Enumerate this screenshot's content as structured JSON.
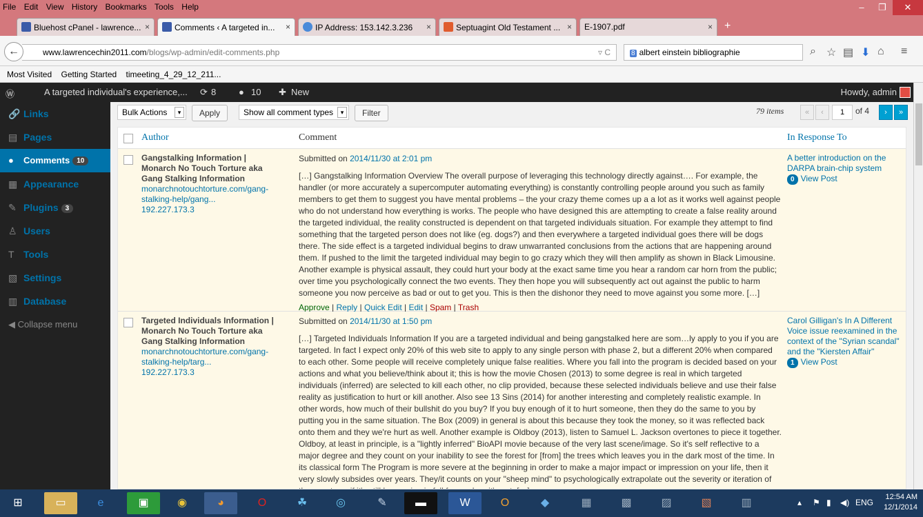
{
  "browser": {
    "menu": [
      "File",
      "Edit",
      "View",
      "History",
      "Bookmarks",
      "Tools",
      "Help"
    ],
    "tabs": [
      {
        "label": "Bluehost cPanel - lawrence...",
        "close": "×",
        "color": "#3b5ba8"
      },
      {
        "label": "Comments ‹ A targeted in...",
        "close": "×",
        "color": "#3b5ba8"
      },
      {
        "label": "IP Address: 153.142.3.236",
        "close": "×",
        "color": "#4b8ad9"
      },
      {
        "label": "Septuagint Old Testament ...",
        "close": "×",
        "color": "#e05c2e"
      },
      {
        "label": "E-1907.pdf",
        "close": "×",
        "color": "#e6d8d9"
      }
    ],
    "new_tab": "+",
    "url_host": "www.lawrencechin2011.com",
    "url_path": "/blogs/wp-admin/edit-comments.php",
    "search": "albert einstein bibliographie",
    "bookmarks": [
      "Most Visited",
      "Getting Started",
      "timeeting_4_29_12_211..."
    ]
  },
  "adminbar": {
    "site": "A targeted individual's experience,...",
    "updates": "8",
    "comments": "10",
    "new": "New",
    "howdy": "Howdy, admin"
  },
  "sidebar": {
    "items": [
      {
        "label": "Links",
        "icon": "link-icon",
        "glyph": "🔗"
      },
      {
        "label": "Pages",
        "icon": "pages-icon",
        "glyph": "▤"
      },
      {
        "label": "Comments",
        "icon": "comment-icon",
        "glyph": "●",
        "count": "10"
      },
      {
        "label": "Appearance",
        "icon": "appearance-icon",
        "glyph": "▦"
      },
      {
        "label": "Plugins",
        "icon": "plugin-icon",
        "glyph": "✎",
        "count": "3"
      },
      {
        "label": "Users",
        "icon": "users-icon",
        "glyph": "♙"
      },
      {
        "label": "Tools",
        "icon": "tools-icon",
        "glyph": "T"
      },
      {
        "label": "Settings",
        "icon": "settings-icon",
        "glyph": "▧"
      },
      {
        "label": "Database",
        "icon": "database-icon",
        "glyph": "▥"
      }
    ],
    "collapse": "Collapse menu"
  },
  "toolbar": {
    "bulk": "Bulk Actions",
    "apply": "Apply",
    "types": "Show all comment types",
    "filter": "Filter",
    "items": "79 items",
    "first": "«",
    "prev": "‹",
    "page": "1",
    "of": "of 4",
    "next": "›",
    "last": "»"
  },
  "table": {
    "col_author": "Author",
    "col_comment": "Comment",
    "col_response": "In Response To"
  },
  "comments": [
    {
      "author": "Gangstalking Information | Monarch No Touch Torture aka Gang Stalking Information",
      "url": "monarchnotouchtorture.com/gang-stalking-help/gang...",
      "ip": "192.227.173.3",
      "submitted_prefix": "Submitted on",
      "date": "2014/11/30 at 2:01 pm",
      "text": "[…] Gangstalking Information Overview The overall purpose of leveraging this technology directly against…. For example, the handler (or more accurately a supercomputer automating everything) is constantly controlling people around you such as family members to get them to suggest you have mental problems – the your crazy theme comes up a a lot as it works well against people who do not understand how everything is works. The people who have designed this are attempting to create a false reality around the targeted individual, the reality constructed is dependent on that targeted individuals situation. For example they attempt to find something that the targeted person does not like (eg. dogs?) and then everywhere a targeted individual goes there will be dogs there. The side effect is a targeted individual begins to draw unwarranted conclusions from the actions that are happening around them. If pushed to the limit the targeted individual may begin to go crazy which they will then amplify as shown in Black Limousine. Another example is physical assault, they could hurt your body at the exact same time you hear a random car horn from the public; over time you psychologically connect the two events. They then hope you will subsequently act out against the public to harm someone you now perceive as bad or out to get you. This is then the dishonor they need to move against you some more. […]",
      "actions": {
        "approve": "Approve",
        "reply": "Reply",
        "quick": "Quick Edit",
        "edit": "Edit",
        "spam": "Spam",
        "trash": "Trash"
      },
      "response": "A better introduction on the DARPA brain-chip system",
      "resp_count": "0",
      "view": "View Post"
    },
    {
      "author": "Targeted Individuals Information | Monarch No Touch Torture aka Gang Stalking Information",
      "url": "monarchnotouchtorture.com/gang-stalking-help/targ...",
      "ip": "192.227.173.3",
      "submitted_prefix": "Submitted on",
      "date": "2014/11/30 at 1:50 pm",
      "text": "[…] Targeted Individuals Information If you are a targeted individual and being gangstalked here are som…ly apply to you if you are targeted. In fact I expect only 20% of this web site to apply to any single person with phase 2, but a different 20% when compared to each other. Some people will receive completely unique false realities. Where you fall into the program is decided based on your actions and what you believe/think about it; this is how the movie Chosen (2013) to some degree is real in which targeted individuals (inferred) are selected to kill each other, no clip provided, because these selected individuals believe and use their false reality as justification to hurt or kill another. Also see 13 Sins (2014) for another interesting and completely realistic example. In other words, how much of their bullshit do you buy? If you buy enough of it to hurt someone, then they do the same to you by putting you in the same situation. The Box (2009) in general is about this because they took the money, so it was reflected back onto them and they we're hurt as well. Another example is Oldboy (2013), listen to Samuel L. Jackson overtones to piece it together. Oldboy, at least in principle, is a \"lightly inferred\" BioAPI movie because of the very last scene/image. So it's self reflective to a major degree and they count on your inability to see the forest for [from] the trees which leaves you in the dark most of the time. In its classical form The Program is more severe at the beginning in order to make a major impact or impression on your life, then it very slowly subsides over years. They/it counts on your \"sheep mind\" to psychologically extrapolate out the severity or iteration of the events as if it's still happening in full force when it's not. […]",
      "response": "Carol Gilligan's In A Different Voice issue reexamined in the context of the \"Syrian scandal\" and the \"Kiersten Affair\"",
      "resp_count": "1",
      "view": "View Post"
    }
  ],
  "taskbar": {
    "lang": "ENG",
    "time": "12:54 AM",
    "date": "12/1/2014"
  }
}
